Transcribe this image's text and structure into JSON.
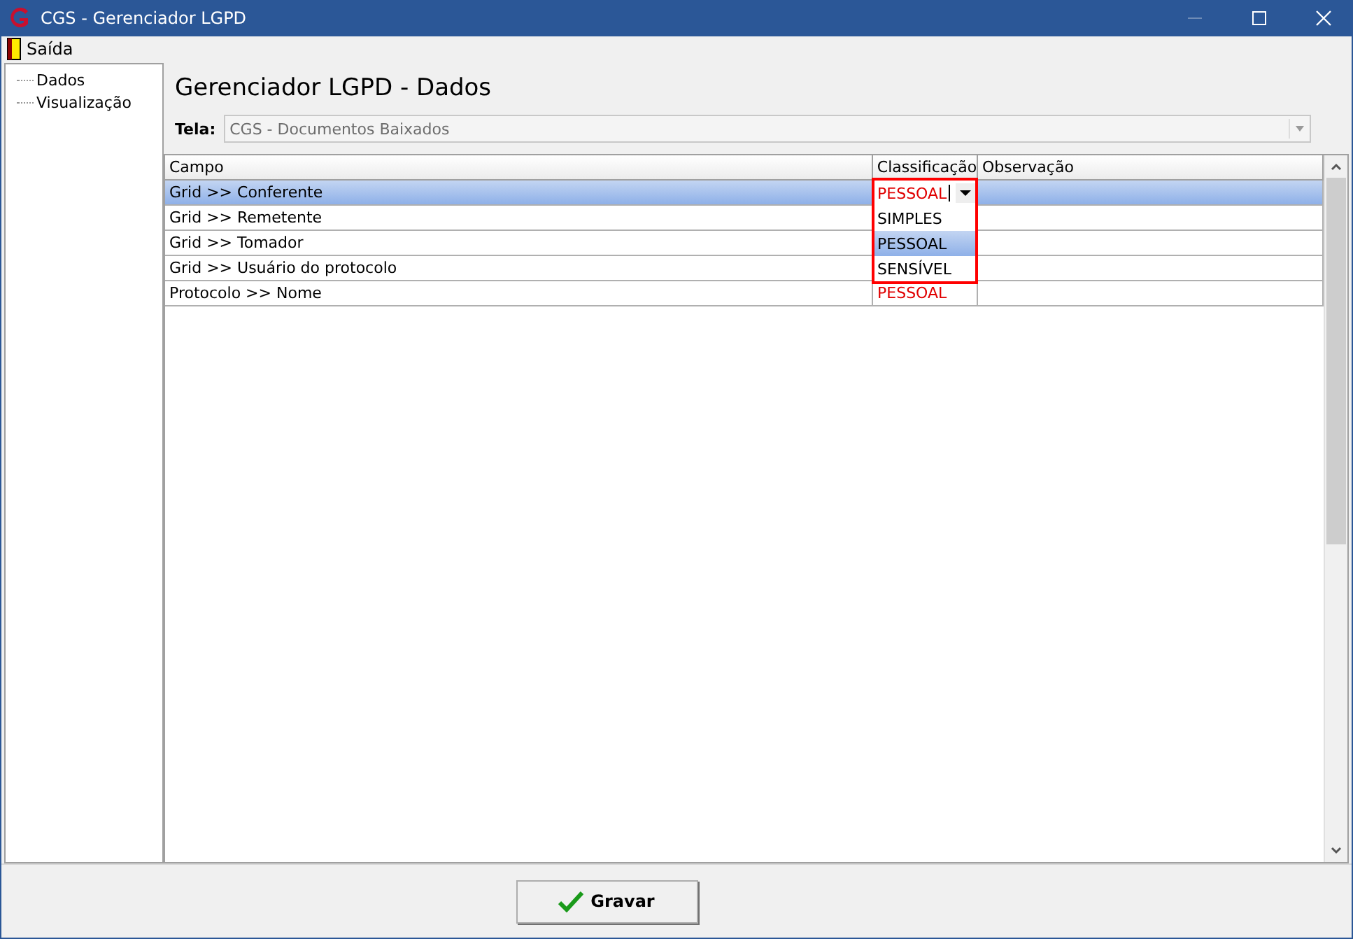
{
  "window": {
    "title": "CGS - Gerenciador LGPD"
  },
  "menu": [
    "Saída"
  ],
  "tree": [
    "Dados",
    "Visualização"
  ],
  "heading": "Gerenciador LGPD - Dados",
  "tela": {
    "label": "Tela:",
    "value": "CGS - Documentos Baixados"
  },
  "table": {
    "columns": [
      "Campo",
      "Classificação",
      "Observação"
    ],
    "rows": [
      {
        "campo": "Grid >> Conferente",
        "classificacao": "",
        "selected": true
      },
      {
        "campo": "Grid >> Remetente",
        "classificacao": "",
        "selected": false
      },
      {
        "campo": "Grid >> Tomador",
        "classificacao": "",
        "selected": false
      },
      {
        "campo": "Grid >> Usuário do protocolo",
        "classificacao": "",
        "selected": false
      },
      {
        "campo": "Protocolo >> Nome",
        "classificacao": "PESSOAL",
        "selected": false
      }
    ]
  },
  "editor": {
    "value": "PESSOAL",
    "options": [
      {
        "label": "SIMPLES",
        "selected": false
      },
      {
        "label": "PESSOAL",
        "selected": true
      },
      {
        "label": "SENSÍVEL",
        "selected": false
      }
    ]
  },
  "save_button": "Gravar"
}
